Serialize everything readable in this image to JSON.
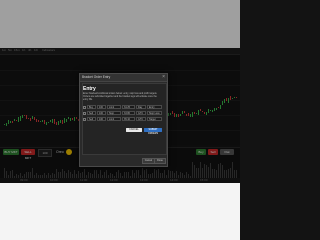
{
  "toolbar": {
    "items": [
      "1m",
      "5m",
      "15m",
      "1h",
      "4h",
      "1D",
      "Indicators"
    ]
  },
  "chart": {
    "y_labels": [
      "—",
      "—",
      "—",
      "—",
      "—",
      "—"
    ],
    "time_labels": [
      "09:00",
      "10:00",
      "11:00",
      "12:00",
      "13:00",
      "14:00",
      "15:00"
    ]
  },
  "trading": {
    "buy_label": "BUY MKT",
    "sell_label": "SELL MKT",
    "quantity": "100",
    "ticker": "Oreo",
    "right_buttons": [
      "Buy",
      "Sell",
      "Flat"
    ]
  },
  "dialog": {
    "window_title": "Bracket Order Entry",
    "close_glyph": "×",
    "heading": "Entry",
    "description": "Enter bracket/conditional orders below: entry, stop loss and profit targets. Orders are submitted together and the bracket legs will activate once the entry fills.",
    "rows": [
      {
        "side": "Buy",
        "qty": "100",
        "type": "Limit",
        "price": "34.25",
        "tif": "Day",
        "tag": "Entry"
      },
      {
        "side": "Sell",
        "qty": "100",
        "type": "Stop",
        "price": "33.80",
        "tif": "GTC",
        "tag": "Stop Loss"
      },
      {
        "side": "Sell",
        "qty": "100",
        "type": "Limit",
        "price": "35.10",
        "tif": "GTC",
        "tag": "Target"
      }
    ],
    "cancel_label": "CANCEL",
    "submit_label": "SUBMIT ORDERS",
    "footer_buttons": [
      "Cancel",
      "Done"
    ]
  },
  "colors": {
    "buy": "#2e7d32",
    "sell": "#c62828",
    "accent": "#2f6fc2",
    "candle_up": "#3bb54a",
    "candle_down": "#d23b3b"
  }
}
